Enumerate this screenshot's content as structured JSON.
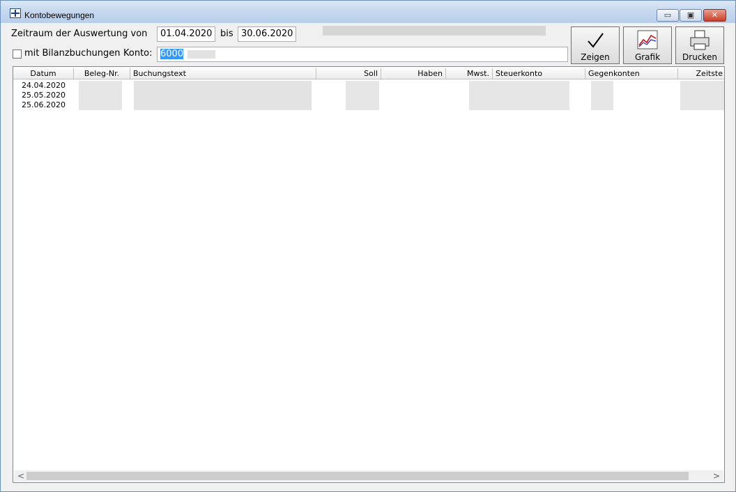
{
  "window": {
    "title": "Kontobewegungen",
    "title_min": "▭",
    "title_max": "▣",
    "title_close": "✕"
  },
  "filter": {
    "period_label": "Zeitraum der Auswertung von",
    "from_date": "01.04.2020",
    "to_label": "bis",
    "to_date": "30.06.2020",
    "bilanz_label": "mit Bilanzbuchungen",
    "konto_label": "Konto:",
    "konto_value": "6000",
    "bilanz_checked": false
  },
  "toolbar": {
    "zeigen": "Zeigen",
    "grafik": "Grafik",
    "drucken": "Drucken"
  },
  "table": {
    "columns": [
      "Datum",
      "Beleg-Nr.",
      "Buchungstext",
      "Soll",
      "Haben",
      "Mwst.",
      "Steuerkonto",
      "Gegenkonten",
      "Zeitste"
    ],
    "rows": [
      {
        "datum": "24.04.2020"
      },
      {
        "datum": "25.05.2020"
      },
      {
        "datum": "25.06.2020"
      }
    ]
  },
  "scrollbar": {
    "left": "<",
    "right": ">"
  }
}
